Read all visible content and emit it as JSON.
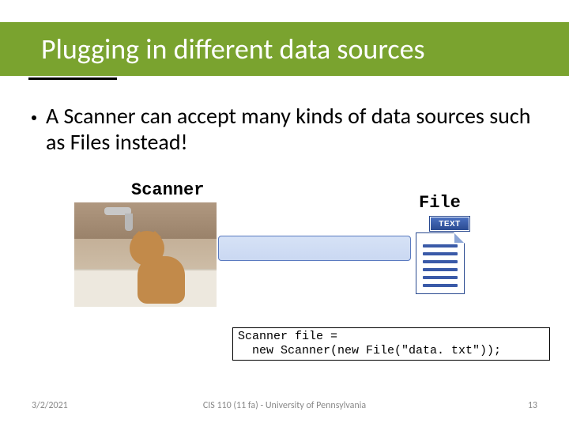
{
  "title": "Plugging in different data sources",
  "bullet": "A Scanner can accept many kinds of data sources such as Files instead!",
  "diagram": {
    "scanner_label": "Scanner",
    "file_label": "File",
    "file_badge": "TEXT"
  },
  "code": {
    "line1": "Scanner file =",
    "line2": "  new Scanner(new File(\"data. txt\"));"
  },
  "footer": {
    "date": "3/2/2021",
    "center": "CIS 110 (11 fa) - University of Pennsylvania",
    "page": "13"
  },
  "colors": {
    "accent": "#7aa32f",
    "link_blue": "#3a5aa8"
  }
}
